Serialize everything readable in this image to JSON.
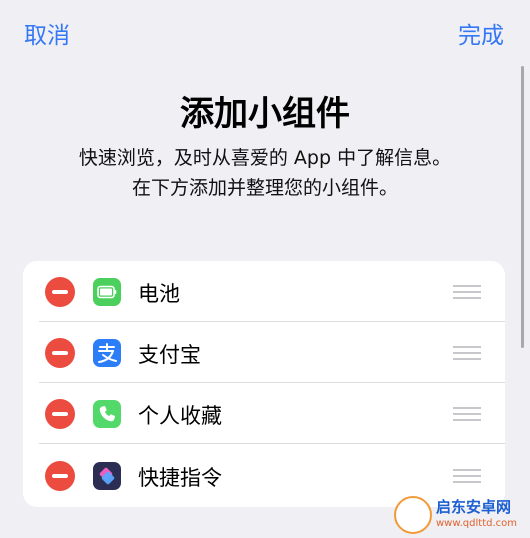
{
  "nav": {
    "cancel_label": "取消",
    "done_label": "完成",
    "accent_color": "#3478f6"
  },
  "header": {
    "title": "添加小组件",
    "subtitle_line1": "快速浏览，及时从喜爱的 App 中了解信息。",
    "subtitle_line2": "在下方添加并整理您的小组件。"
  },
  "widgets": [
    {
      "label": "电池",
      "icon": "battery-icon",
      "icon_color": "#4bd05e"
    },
    {
      "label": "支付宝",
      "icon": "alipay-icon",
      "icon_color": "#2c7ef8"
    },
    {
      "label": "个人收藏",
      "icon": "phone-icon",
      "icon_color": "#53d969"
    },
    {
      "label": "快捷指令",
      "icon": "shortcuts-icon",
      "icon_color": "#2b2e52"
    }
  ],
  "remove_color": "#ec4b3f",
  "watermark": {
    "title": "启东安卓网",
    "url": "www.qdlttd.com"
  }
}
